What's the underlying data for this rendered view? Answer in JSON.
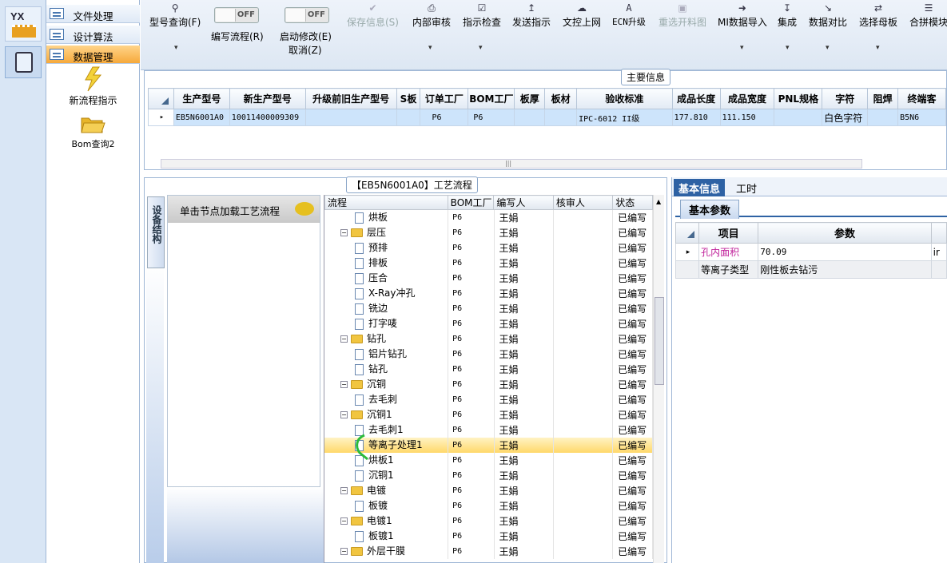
{
  "rail": {
    "logo_text": "YX"
  },
  "menu": {
    "items": [
      {
        "label": "文件处理"
      },
      {
        "label": "设计算法"
      },
      {
        "label": "数据管理"
      }
    ],
    "sub_items": [
      {
        "label": "新流程指示",
        "icon": "lightning-icon"
      },
      {
        "label": "Bom查询2",
        "icon": "folder-open-icon"
      }
    ]
  },
  "toolbar": {
    "model_query": "型号查询(F)",
    "toggle1_state": "OFF",
    "toggle2_state": "OFF",
    "edit_flow": "编写流程(R)",
    "start_modify": "启动修改(E)",
    "cancel": "取消(Z)",
    "save_info": "保存信息(S)",
    "internal_review": "内部审核",
    "instruction_check": "指示检查",
    "send_instruction": "发送指示",
    "doc_upload": "文控上网",
    "ecn_upgrade": "ECN升级",
    "reset_material": "重选开料图",
    "mi_import": "MI数据导入",
    "integrate": "集成",
    "data_compare": "数据对比",
    "select_mother": "选择母板",
    "merge_module": "合拼模块",
    "dropdown_glyph": "▾"
  },
  "main_info": {
    "title": "主要信息",
    "columns": [
      "生产型号",
      "新生产型号",
      "升级前旧生产型号",
      "S板",
      "订单工厂",
      "BOM工厂",
      "板厚",
      "板材",
      "验收标准",
      "成品长度",
      "成品宽度",
      "PNL规格",
      "字符",
      "阻焊",
      "终端客"
    ],
    "rows": [
      [
        "EB5N6001A0",
        "10011400009309",
        "",
        "",
        "P6",
        "P6",
        "",
        "",
        "IPC-6012 II级",
        "177.810",
        "111.150",
        "",
        "白色字符",
        "",
        "B5N6"
      ]
    ],
    "row_marker": "▸",
    "scroll_grip": "|||"
  },
  "process": {
    "title": "【EB5N6001A0】工艺流程",
    "side_tab": "设备结构",
    "node_hint": "单击节点加载工艺流程",
    "columns": [
      "流程",
      "BOM工厂",
      "编写人",
      "核审人",
      "状态"
    ],
    "rows": [
      {
        "name": "烘板",
        "level": 2,
        "type": "doc",
        "factory": "P6",
        "writer": "王娟",
        "reviewer": "",
        "status": "已编写"
      },
      {
        "name": "层压",
        "level": 1,
        "type": "folder",
        "factory": "P6",
        "writer": "王娟",
        "reviewer": "",
        "status": "已编写"
      },
      {
        "name": "预排",
        "level": 2,
        "type": "doc",
        "factory": "P6",
        "writer": "王娟",
        "reviewer": "",
        "status": "已编写"
      },
      {
        "name": "排板",
        "level": 2,
        "type": "doc",
        "factory": "P6",
        "writer": "王娟",
        "reviewer": "",
        "status": "已编写"
      },
      {
        "name": "压合",
        "level": 2,
        "type": "doc",
        "factory": "P6",
        "writer": "王娟",
        "reviewer": "",
        "status": "已编写"
      },
      {
        "name": "X-Ray冲孔",
        "level": 2,
        "type": "doc",
        "factory": "P6",
        "writer": "王娟",
        "reviewer": "",
        "status": "已编写"
      },
      {
        "name": "铣边",
        "level": 2,
        "type": "doc",
        "factory": "P6",
        "writer": "王娟",
        "reviewer": "",
        "status": "已编写"
      },
      {
        "name": "打字唛",
        "level": 2,
        "type": "doc",
        "factory": "P6",
        "writer": "王娟",
        "reviewer": "",
        "status": "已编写"
      },
      {
        "name": "钻孔",
        "level": 1,
        "type": "folder",
        "factory": "P6",
        "writer": "王娟",
        "reviewer": "",
        "status": "已编写"
      },
      {
        "name": "铝片钻孔",
        "level": 2,
        "type": "doc",
        "factory": "P6",
        "writer": "王娟",
        "reviewer": "",
        "status": "已编写"
      },
      {
        "name": "钻孔",
        "level": 2,
        "type": "doc",
        "factory": "P6",
        "writer": "王娟",
        "reviewer": "",
        "status": "已编写"
      },
      {
        "name": "沉铜",
        "level": 1,
        "type": "folder",
        "factory": "P6",
        "writer": "王娟",
        "reviewer": "",
        "status": "已编写"
      },
      {
        "name": "去毛刺",
        "level": 2,
        "type": "doc",
        "factory": "P6",
        "writer": "王娟",
        "reviewer": "",
        "status": "已编写"
      },
      {
        "name": "沉铜1",
        "level": 1,
        "type": "folder",
        "factory": "P6",
        "writer": "王娟",
        "reviewer": "",
        "status": "已编写"
      },
      {
        "name": "去毛刺1",
        "level": 2,
        "type": "doc",
        "factory": "P6",
        "writer": "王娟",
        "reviewer": "",
        "status": "已编写"
      },
      {
        "name": "等离子处理1",
        "level": 2,
        "type": "doc",
        "factory": "P6",
        "writer": "王娟",
        "reviewer": "",
        "status": "已编写",
        "selected": true
      },
      {
        "name": "烘板1",
        "level": 2,
        "type": "doc",
        "factory": "P6",
        "writer": "王娟",
        "reviewer": "",
        "status": "已编写"
      },
      {
        "name": "沉铜1",
        "level": 2,
        "type": "doc",
        "factory": "P6",
        "writer": "王娟",
        "reviewer": "",
        "status": "已编写"
      },
      {
        "name": "电镀",
        "level": 1,
        "type": "folder",
        "factory": "P6",
        "writer": "王娟",
        "reviewer": "",
        "status": "已编写"
      },
      {
        "name": "板镀",
        "level": 2,
        "type": "doc",
        "factory": "P6",
        "writer": "王娟",
        "reviewer": "",
        "status": "已编写"
      },
      {
        "name": "电镀1",
        "level": 1,
        "type": "folder",
        "factory": "P6",
        "writer": "王娟",
        "reviewer": "",
        "status": "已编写"
      },
      {
        "name": "板镀1",
        "level": 2,
        "type": "doc",
        "factory": "P6",
        "writer": "王娟",
        "reviewer": "",
        "status": "已编写"
      },
      {
        "name": "外层干膜",
        "level": 1,
        "type": "folder",
        "factory": "P6",
        "writer": "王娟",
        "reviewer": "",
        "status": "已编写"
      }
    ]
  },
  "right_panel": {
    "tabs": [
      "基本信息",
      "工时"
    ],
    "sub_tab": "基本参数",
    "columns": [
      "项目",
      "参数"
    ],
    "rows": [
      {
        "item": "孔内面积",
        "value": "70.09",
        "extra": "ir",
        "color": "#c0209a"
      },
      {
        "item": "等离子类型",
        "value": "刚性板去钻污",
        "extra": "",
        "color": "#000000"
      }
    ]
  },
  "colors": {
    "accent": "#2e62a4",
    "selected_row": "#ffd86a",
    "main_row": "#cde4fb",
    "menu_selected": "#f6a93b"
  }
}
